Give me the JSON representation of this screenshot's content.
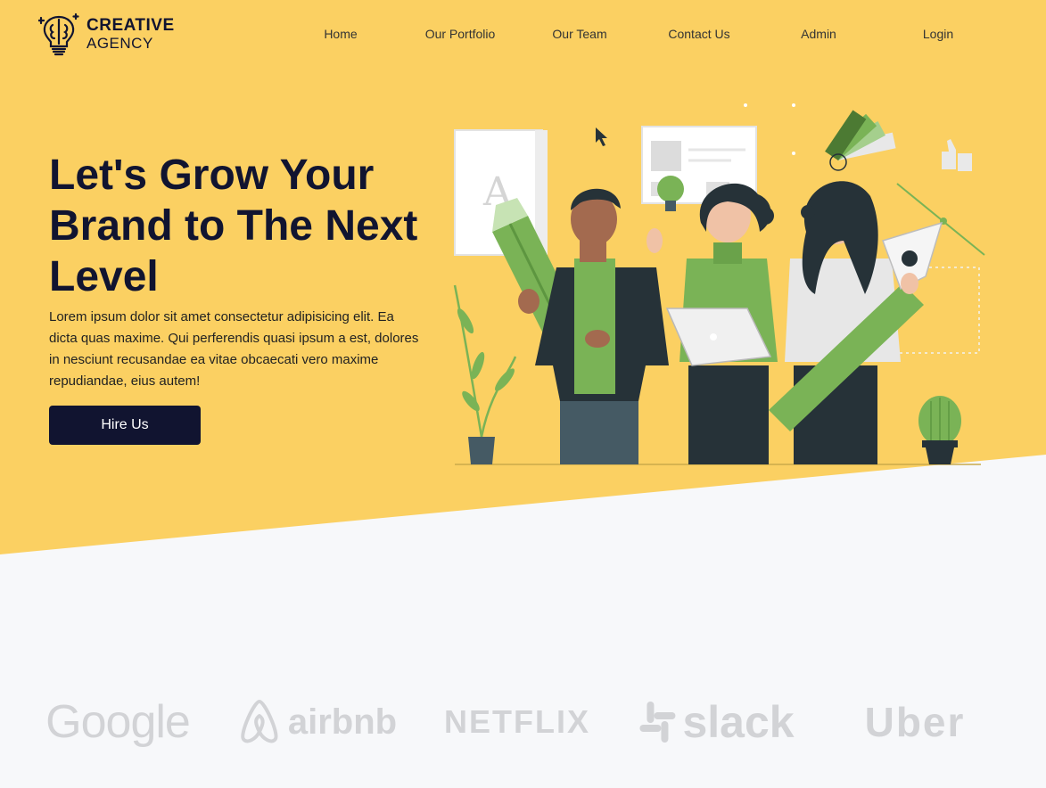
{
  "brand": {
    "line1": "CREATIVE",
    "line2": "AGENCY",
    "icon": "brain-bulb-icon"
  },
  "nav": {
    "items": [
      {
        "label": "Home"
      },
      {
        "label": "Our Portfolio"
      },
      {
        "label": "Our Team"
      },
      {
        "label": "Contact Us"
      },
      {
        "label": "Admin"
      },
      {
        "label": "Login"
      }
    ]
  },
  "hero": {
    "title": "Let's Grow Your Brand to The Next Level",
    "text": "Lorem ipsum dolor sit amet consectetur adipisicing elit. Ea dicta quas maxime. Qui perferendis quasi ipsum a est, dolores in nesciunt recusandae ea vitae obcaecati vero maxime repudiandae, eius autem!",
    "button": "Hire Us"
  },
  "clients": [
    {
      "name": "Google"
    },
    {
      "name": "airbnb"
    },
    {
      "name": "NETFLIX"
    },
    {
      "name": "slack"
    },
    {
      "name": "Uber"
    }
  ],
  "colors": {
    "hero_background": "#fbd062",
    "primary_dark": "#111430",
    "page_background": "#f7f8fa",
    "logo_gray": "#d2d3d6",
    "illustration_green": "#7ab356"
  }
}
